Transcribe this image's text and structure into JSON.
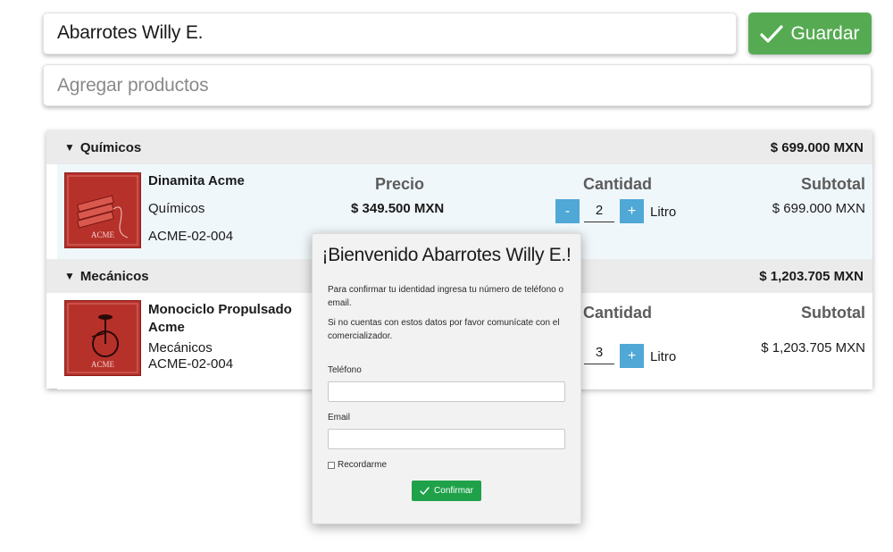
{
  "header": {
    "store_name": "Abarrotes Willy E.",
    "save_label": "Guardar",
    "add_placeholder": "Agregar productos"
  },
  "columns": {
    "price": "Precio",
    "quantity": "Cantidad",
    "subtotal": "Subtotal"
  },
  "categories": [
    {
      "name": "Químicos",
      "total": "$ 699.000 MXN",
      "product": {
        "name": "Dinamita Acme",
        "category": "Químicos",
        "sku": "ACME-02-004",
        "price": "$ 349.500 MXN",
        "quantity": "2",
        "unit": "Litro",
        "subtotal": "$ 699.000  MXN",
        "minus": "-",
        "plus": "+"
      }
    },
    {
      "name": "Mecánicos",
      "total": "$ 1,203.705 MXN",
      "product": {
        "name": "Monociclo Propulsado Acme",
        "category": "Mecánicos",
        "sku": "ACME-02-004",
        "quantity": "3",
        "unit": "Litro",
        "subtotal": "$ 1,203.705  MXN",
        "plus": "+"
      }
    }
  ],
  "modal": {
    "title": "¡Bienvenido Abarrotes Willy E.!",
    "paragraph1": "Para confirmar tu identidad ingresa tu número de teléfono o email.",
    "paragraph2": "Si no cuentas con estos datos por favor comunícate con el comercializador.",
    "phone_label": "Teléfono",
    "email_label": "Email",
    "remember_label": "Recordarme",
    "confirm_label": "Confirmar"
  },
  "colors": {
    "save": "#56ab52",
    "qty_button": "#4fa8d6",
    "confirm": "#1fa14a",
    "product_image": "#b7312b"
  },
  "icons": [
    "check-icon",
    "triangle-down-icon"
  ]
}
